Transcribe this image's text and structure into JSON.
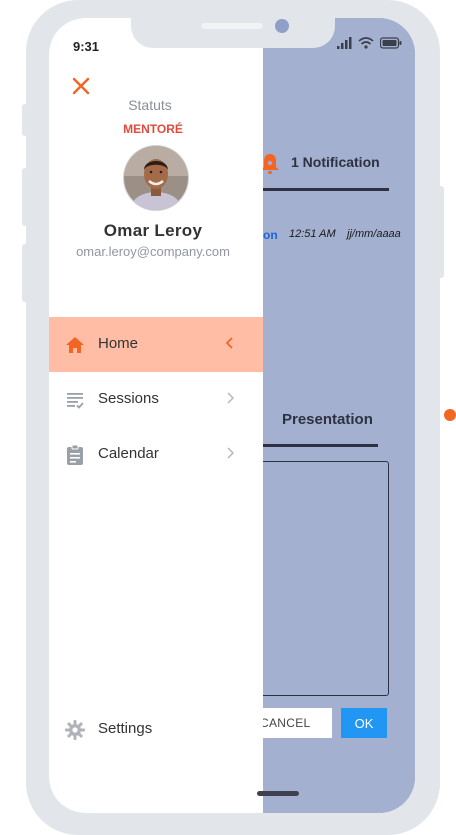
{
  "status_bar": {
    "time": "9:31"
  },
  "drawer": {
    "statut_label": "Statuts",
    "statut_value": "MENTORÉ",
    "user": {
      "name": "Omar Leroy",
      "email": "omar.leroy@company.com"
    },
    "menu": [
      {
        "label": "Home",
        "icon": "home-icon",
        "active": true
      },
      {
        "label": "Sessions",
        "icon": "list-icon",
        "active": false
      },
      {
        "label": "Calendar",
        "icon": "clipboard-icon",
        "active": false
      }
    ],
    "settings_label": "Settings"
  },
  "background": {
    "notification_label": "1 Notification",
    "row": {
      "prefix": "on",
      "time": "12:51 AM",
      "date": "jj/mm/aaaa"
    },
    "presentation_tab": "Presentation",
    "cancel_label": "CANCEL",
    "ok_label": "OK"
  },
  "colors": {
    "accent": "#f26522",
    "active_item": "#ffbda6",
    "status_red": "#e04a3f",
    "overlay_bg": "#a4b0cf",
    "ok_button": "#2196f3"
  }
}
